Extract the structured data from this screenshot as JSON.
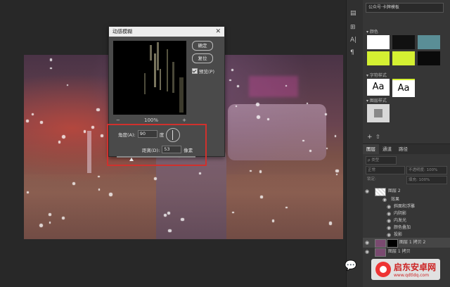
{
  "dialog": {
    "title": "动感模糊",
    "ok_label": "确定",
    "reset_label": "复位",
    "preview_label": "预览(P)",
    "zoom_out_icon": "−",
    "zoom_in_icon": "+",
    "zoom_level": "100%",
    "angle_label": "角度(A):",
    "angle_value": "90",
    "angle_unit": "度",
    "distance_label": "距离(D):",
    "distance_value": "53",
    "distance_unit": "像素"
  },
  "panel": {
    "dropdown": "公众号·卡牌模板",
    "swatches_header": "▾ 颜色",
    "char_styles_header": "▾ 字符样式",
    "aa_label": "Aa",
    "shapes_header": "▾ 图层样式",
    "swatch_colors": [
      "#ffffff",
      "#111111",
      "#5a8e96",
      "#d4f032",
      "#d4f032",
      "#0a0a0a"
    ],
    "tabs": [
      "图层",
      "通道",
      "路径"
    ],
    "kind_placeholder": "ρ 类型",
    "blend_mode": "正常",
    "opacity": "不透明度: 100%",
    "lock_label": "锁定:",
    "fill": "填充: 100%",
    "layers": [
      {
        "name": "图层 2"
      },
      {
        "name": "效果"
      },
      {
        "name": "斜面和浮雕"
      },
      {
        "name": "内阴影"
      },
      {
        "name": "内发光"
      },
      {
        "name": "颜色叠加"
      },
      {
        "name": "投影"
      },
      {
        "name": "图层 1 拷贝 2"
      },
      {
        "name": "图层 1 拷贝"
      }
    ]
  },
  "watermark": {
    "name": "启东安卓网",
    "url": "www.qdtldq.com"
  }
}
